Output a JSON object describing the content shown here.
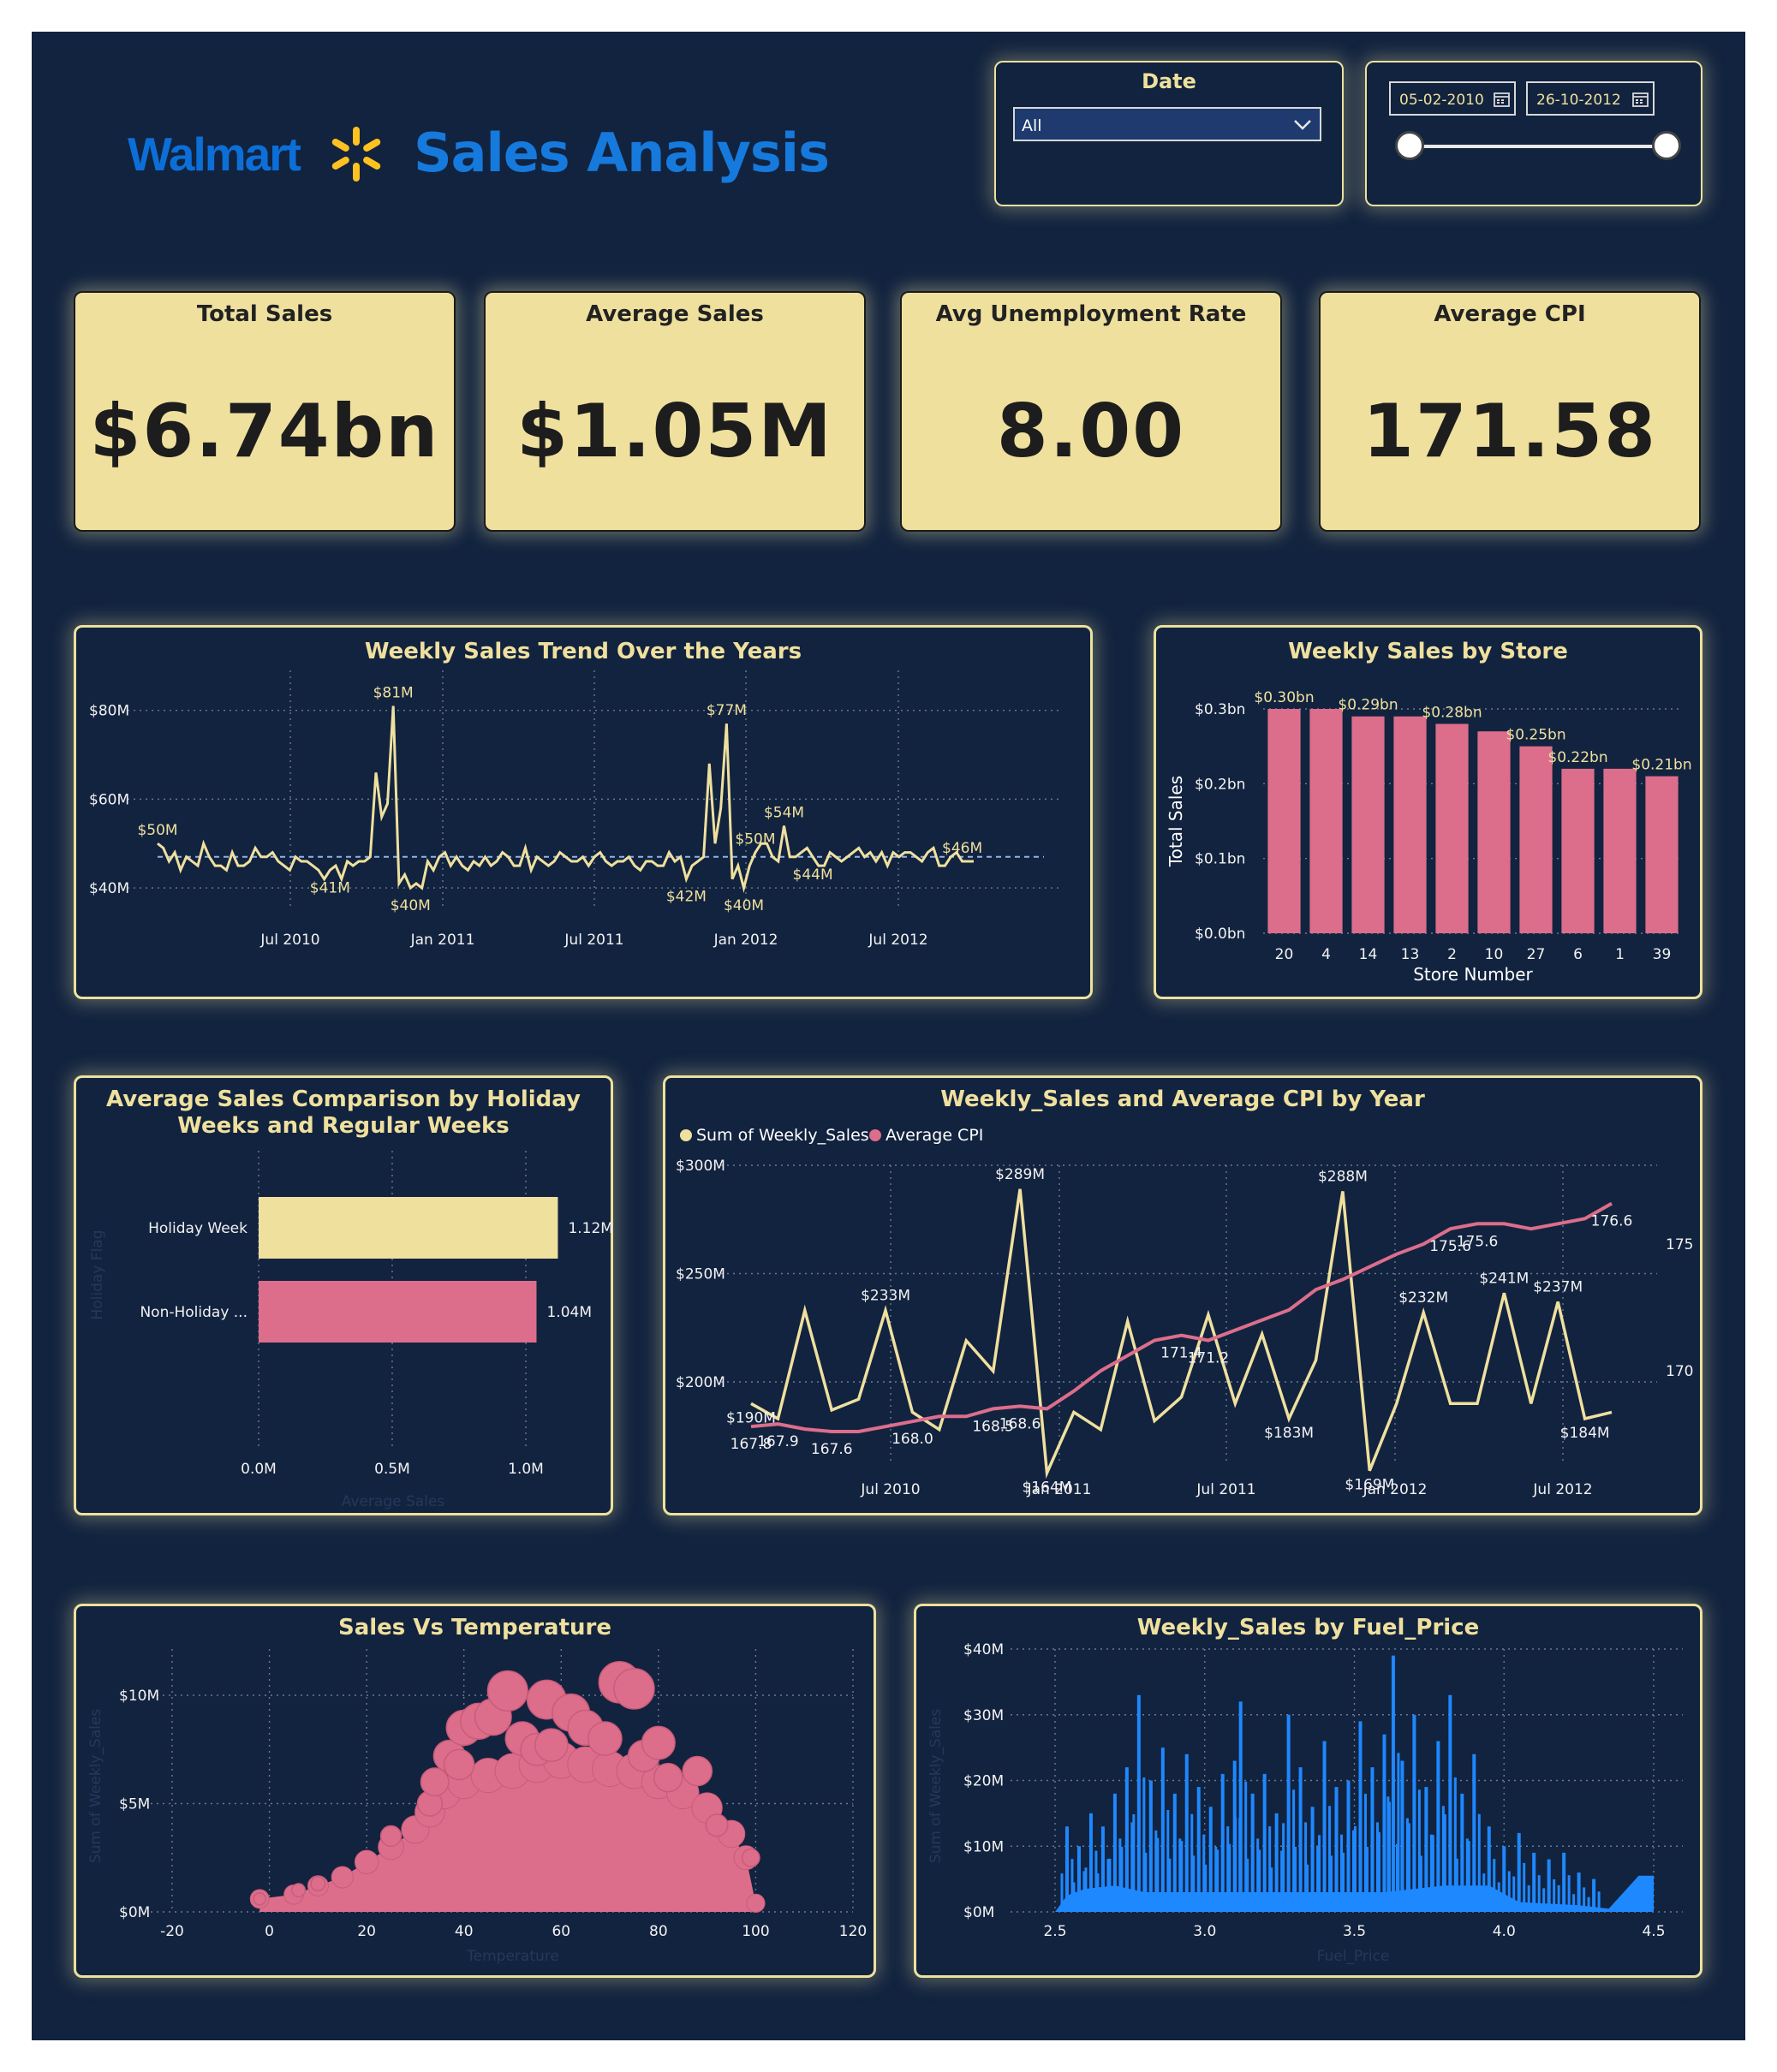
{
  "header": {
    "brand": "Walmart",
    "title": "Sales Analysis"
  },
  "filters": {
    "date_label": "Date",
    "date_select_value": "All",
    "range_start": "05-02-2010",
    "range_end": "26-10-2012",
    "slider_start": 0,
    "slider_end": 1
  },
  "kpis": [
    {
      "label": "Total Sales",
      "value": "$6.74bn"
    },
    {
      "label": "Average Sales",
      "value": "$1.05M"
    },
    {
      "label": "Avg Unemployment Rate",
      "value": "8.00"
    },
    {
      "label": "Average CPI",
      "value": "171.58"
    }
  ],
  "colors": {
    "background": "#12233f",
    "accent_yellow": "#efe09e",
    "accent_pink": "#dc6e8c",
    "accent_blue": "#1e88ff",
    "brand_blue": "#0c6fd8",
    "spark_yellow": "#ffc220"
  },
  "chart_data": [
    {
      "id": "weekly_trend",
      "type": "line",
      "title": "Weekly Sales Trend Over the Years",
      "x_ticks": [
        "Jul 2010",
        "Jan 2011",
        "Jul 2011",
        "Jan 2012",
        "Jul 2012"
      ],
      "y_ticks": [
        "$40M",
        "$60M",
        "$80M"
      ],
      "ylim": [
        35,
        89
      ],
      "average_line": 47,
      "values": [
        50,
        49,
        46,
        48,
        44,
        47,
        46,
        45,
        50,
        47,
        45,
        45,
        44,
        48,
        45,
        45,
        46,
        49,
        47,
        47,
        48,
        46,
        45,
        44,
        47,
        46,
        46,
        45,
        44,
        42,
        44,
        45,
        42,
        46,
        45,
        46,
        46,
        47,
        66,
        56,
        59,
        81,
        41,
        43,
        40,
        41,
        40,
        46,
        44,
        47,
        48,
        45,
        47,
        45,
        44,
        46,
        45,
        47,
        45,
        46,
        48,
        47,
        45,
        45,
        49,
        44,
        47,
        46,
        45,
        46,
        48,
        47,
        46,
        46,
        47,
        45,
        47,
        48,
        46,
        45,
        46,
        46,
        47,
        45,
        44,
        46,
        46,
        45,
        45,
        48,
        46,
        47,
        42,
        45,
        46,
        47,
        68,
        50,
        58,
        77,
        42,
        45,
        40,
        45,
        48,
        50,
        50,
        47,
        46,
        54,
        47,
        47,
        48,
        49,
        47,
        45,
        45,
        48,
        47,
        46,
        47,
        48,
        49,
        47,
        48,
        46,
        48,
        45,
        48,
        47,
        48,
        48,
        47,
        46,
        48,
        49,
        45,
        45,
        47,
        48,
        46,
        46,
        46
      ],
      "annotations": [
        {
          "label": "$81M",
          "index": 41,
          "pos": "above"
        },
        {
          "label": "$50M",
          "index": 0,
          "pos": "above"
        },
        {
          "label": "$41M",
          "index": 30,
          "pos": "below"
        },
        {
          "label": "$40M",
          "index": 44,
          "pos": "below"
        },
        {
          "label": "$77M",
          "index": 99,
          "pos": "above"
        },
        {
          "label": "$42M",
          "index": 92,
          "pos": "below"
        },
        {
          "label": "$50M",
          "index": 104,
          "pos": "above"
        },
        {
          "label": "$40M",
          "index": 102,
          "pos": "below"
        },
        {
          "label": "$54M",
          "index": 109,
          "pos": "above"
        },
        {
          "label": "$44M",
          "index": 114,
          "pos": "below"
        },
        {
          "label": "$46M",
          "index": 140,
          "pos": "above"
        }
      ]
    },
    {
      "id": "store_sales",
      "type": "bar",
      "title": "Weekly Sales by Store",
      "xlabel": "Store Number",
      "ylabel": "Total Sales",
      "categories": [
        "20",
        "4",
        "14",
        "13",
        "2",
        "10",
        "27",
        "6",
        "1",
        "39"
      ],
      "values": [
        0.3,
        0.3,
        0.29,
        0.29,
        0.28,
        0.27,
        0.25,
        0.22,
        0.22,
        0.21
      ],
      "data_labels": [
        "$0.30bn",
        "",
        "$0.29bn",
        "",
        "$0.28bn",
        "",
        "$0.25bn",
        "$0.22bn",
        "",
        "$0.21bn"
      ],
      "y_ticks": [
        "$0.0bn",
        "$0.1bn",
        "$0.2bn",
        "$0.3bn"
      ],
      "ylim": [
        0,
        0.3
      ]
    },
    {
      "id": "holiday_comparison",
      "type": "bar",
      "orientation": "horizontal",
      "title": "Average Sales Comparison by Holiday Weeks and Regular Weeks",
      "categories": [
        "Holiday Week",
        "Non-Holiday ..."
      ],
      "values": [
        1.12,
        1.04
      ],
      "data_labels": [
        "1.12M",
        "1.04M"
      ],
      "x_ticks": [
        "0.0M",
        "0.5M",
        "1.0M"
      ],
      "xlim": [
        0,
        1.25
      ],
      "xlabel": "Average Sales",
      "ylabel": "Holiday Flag"
    },
    {
      "id": "sales_cpi_by_year",
      "type": "line",
      "title": "Weekly_Sales and Average CPI by Year",
      "series": [
        {
          "name": "Sum of Weekly_Sales",
          "values": [
            190,
            183,
            233,
            187,
            192,
            233,
            186,
            178,
            219,
            205,
            289,
            158,
            186,
            178,
            228,
            182,
            193,
            231,
            190,
            222,
            183,
            210,
            288,
            159,
            190,
            232,
            190,
            190,
            241,
            190,
            237,
            183,
            186
          ]
        },
        {
          "name": "Average CPI",
          "values": [
            167.8,
            167.9,
            167.7,
            167.6,
            167.6,
            167.8,
            168.0,
            168.2,
            168.2,
            168.5,
            168.6,
            168.5,
            169.2,
            170.0,
            170.6,
            171.2,
            171.4,
            171.2,
            171.6,
            172.0,
            172.4,
            173.2,
            173.6,
            174.1,
            174.6,
            175.0,
            175.6,
            175.8,
            175.8,
            175.6,
            175.8,
            176.0,
            176.6
          ]
        }
      ],
      "x_ticks": [
        "Jul 2010",
        "Jan 2011",
        "Jul 2011",
        "Jan 2012",
        "Jul 2012"
      ],
      "y_ticks": [
        "$200M",
        "$250M",
        "$300M"
      ],
      "y2_ticks": [
        "170",
        "175"
      ],
      "ylim": [
        150,
        300
      ],
      "y2lim": [
        166,
        179
      ],
      "annotations": [
        {
          "series": 0,
          "index": 10,
          "label": "$289M"
        },
        {
          "series": 0,
          "index": 5,
          "label": "$233M"
        },
        {
          "series": 0,
          "index": 0,
          "label": "$190M"
        },
        {
          "series": 0,
          "index": 11,
          "label": "$164M"
        },
        {
          "series": 0,
          "index": 20,
          "label": "$183M"
        },
        {
          "series": 0,
          "index": 22,
          "label": "$288M"
        },
        {
          "series": 0,
          "index": 23,
          "label": "$169M"
        },
        {
          "series": 0,
          "index": 25,
          "label": "$232M"
        },
        {
          "series": 0,
          "index": 28,
          "label": "$241M"
        },
        {
          "series": 0,
          "index": 30,
          "label": "$237M"
        },
        {
          "series": 0,
          "index": 31,
          "label": "$184M"
        },
        {
          "series": 1,
          "index": 0,
          "label": "167.8"
        },
        {
          "series": 1,
          "index": 1,
          "label": "167.9"
        },
        {
          "series": 1,
          "index": 3,
          "label": "167.6"
        },
        {
          "series": 1,
          "index": 6,
          "label": "168.0"
        },
        {
          "series": 1,
          "index": 9,
          "label": "168.5"
        },
        {
          "series": 1,
          "index": 10,
          "label": "168.6"
        },
        {
          "series": 1,
          "index": 16,
          "label": "171.4"
        },
        {
          "series": 1,
          "index": 17,
          "label": "171.2"
        },
        {
          "series": 1,
          "index": 26,
          "label": "175.6"
        },
        {
          "series": 1,
          "index": 27,
          "label": "175.6"
        },
        {
          "series": 1,
          "index": 32,
          "label": "176.6"
        }
      ]
    },
    {
      "id": "sales_vs_temperature",
      "type": "scatter",
      "title": "Sales Vs Temperature",
      "xlabel": "Temperature",
      "ylabel": "Sum of Weekly_Sales",
      "x_ticks": [
        "-20",
        "0",
        "20",
        "40",
        "60",
        "80",
        "100",
        "120"
      ],
      "y_ticks": [
        "$0M",
        "$5M",
        "$10M"
      ],
      "xlim": [
        -20,
        120
      ],
      "ylim": [
        0,
        12
      ],
      "envelope": [
        [
          -2,
          0.6
        ],
        [
          5,
          0.8
        ],
        [
          10,
          1.2
        ],
        [
          15,
          1.6
        ],
        [
          20,
          2.3
        ],
        [
          25,
          3.0
        ],
        [
          30,
          3.8
        ],
        [
          33,
          4.6
        ],
        [
          36,
          5.5
        ],
        [
          40,
          6.0
        ],
        [
          45,
          6.3
        ],
        [
          50,
          6.5
        ],
        [
          55,
          6.8
        ],
        [
          60,
          7.0
        ],
        [
          65,
          6.8
        ],
        [
          70,
          6.6
        ],
        [
          75,
          6.5
        ],
        [
          80,
          6.0
        ],
        [
          85,
          5.5
        ],
        [
          90,
          4.8
        ],
        [
          95,
          3.6
        ],
        [
          98,
          2.5
        ],
        [
          100,
          0.4
        ]
      ],
      "outliers": [
        [
          -2,
          0.6
        ],
        [
          6,
          1.0
        ],
        [
          10,
          1.3
        ],
        [
          25,
          3.5
        ],
        [
          33,
          5.0
        ],
        [
          34,
          6.0
        ],
        [
          37,
          7.2
        ],
        [
          39,
          6.8
        ],
        [
          40,
          8.5
        ],
        [
          43,
          8.8
        ],
        [
          46,
          9.0
        ],
        [
          49,
          10.2
        ],
        [
          52,
          8.0
        ],
        [
          55,
          7.5
        ],
        [
          57,
          9.8
        ],
        [
          58,
          7.7
        ],
        [
          62,
          9.2
        ],
        [
          65,
          8.5
        ],
        [
          69,
          8.0
        ],
        [
          72,
          10.6
        ],
        [
          75,
          10.3
        ],
        [
          77,
          7.2
        ],
        [
          80,
          7.8
        ],
        [
          82,
          6.2
        ],
        [
          88,
          6.5
        ],
        [
          92,
          4.0
        ],
        [
          99,
          2.5
        ]
      ]
    },
    {
      "id": "sales_by_fuel_price",
      "type": "area",
      "title": "Weekly_Sales by Fuel_Price",
      "xlabel": "Fuel_Price",
      "ylabel": "Sum of Weekly_Sales",
      "x_ticks": [
        "2.5",
        "3.0",
        "3.5",
        "4.0",
        "4.5"
      ],
      "y_ticks": [
        "$0M",
        "$10M",
        "$20M",
        "$30M",
        "$40M"
      ],
      "xlim": [
        2.47,
        4.53
      ],
      "ylim": [
        0,
        40
      ],
      "baseline_points": [
        [
          2.47,
          0
        ],
        [
          2.5,
          0
        ],
        [
          2.54,
          2.5
        ],
        [
          2.6,
          3.5
        ],
        [
          2.7,
          4
        ],
        [
          2.8,
          3
        ],
        [
          3.0,
          3
        ],
        [
          3.2,
          3
        ],
        [
          3.4,
          3
        ],
        [
          3.6,
          3
        ],
        [
          3.8,
          4
        ],
        [
          3.95,
          4
        ],
        [
          4.05,
          1.5
        ],
        [
          4.25,
          1
        ],
        [
          4.35,
          0.5
        ],
        [
          4.45,
          5.5
        ],
        [
          4.5,
          5.5
        ]
      ],
      "peaks": [
        [
          2.54,
          13
        ],
        [
          2.58,
          10
        ],
        [
          2.62,
          15
        ],
        [
          2.66,
          13
        ],
        [
          2.7,
          18
        ],
        [
          2.74,
          22
        ],
        [
          2.78,
          33
        ],
        [
          2.82,
          20
        ],
        [
          2.86,
          25
        ],
        [
          2.9,
          18
        ],
        [
          2.94,
          24
        ],
        [
          2.98,
          19
        ],
        [
          3.02,
          16
        ],
        [
          3.06,
          21
        ],
        [
          3.1,
          23
        ],
        [
          3.12,
          32
        ],
        [
          3.16,
          18
        ],
        [
          3.2,
          21
        ],
        [
          3.24,
          15
        ],
        [
          3.28,
          30
        ],
        [
          3.32,
          22
        ],
        [
          3.36,
          16
        ],
        [
          3.4,
          26
        ],
        [
          3.44,
          19
        ],
        [
          3.48,
          20
        ],
        [
          3.52,
          29
        ],
        [
          3.56,
          22
        ],
        [
          3.6,
          27
        ],
        [
          3.63,
          39
        ],
        [
          3.66,
          23
        ],
        [
          3.7,
          30
        ],
        [
          3.74,
          19
        ],
        [
          3.78,
          26
        ],
        [
          3.82,
          33
        ],
        [
          3.86,
          18
        ],
        [
          3.9,
          24
        ],
        [
          3.95,
          13
        ],
        [
          4.0,
          10
        ],
        [
          4.05,
          12
        ],
        [
          4.1,
          9
        ],
        [
          4.15,
          8
        ],
        [
          4.2,
          9
        ],
        [
          4.25,
          6
        ],
        [
          4.3,
          5
        ]
      ]
    }
  ]
}
